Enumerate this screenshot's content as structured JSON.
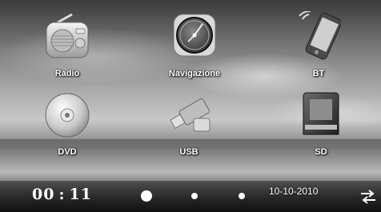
{
  "apps": [
    {
      "label": "Radio",
      "icon": "radio-icon"
    },
    {
      "label": "Navigazione",
      "icon": "clock-compass-icon"
    },
    {
      "label": "BT",
      "icon": "phone-bluetooth-icon"
    },
    {
      "label": "DVD",
      "icon": "disc-icon"
    },
    {
      "label": "USB",
      "icon": "usb-drive-icon"
    },
    {
      "label": "SD",
      "icon": "sd-card-icon"
    }
  ],
  "status": {
    "hours": "00",
    "separator": ":",
    "minutes": "11",
    "date": "10-10-2010",
    "page_indicator": {
      "count": 3,
      "active": 1
    },
    "switch_icon": "swap-arrows-icon"
  }
}
